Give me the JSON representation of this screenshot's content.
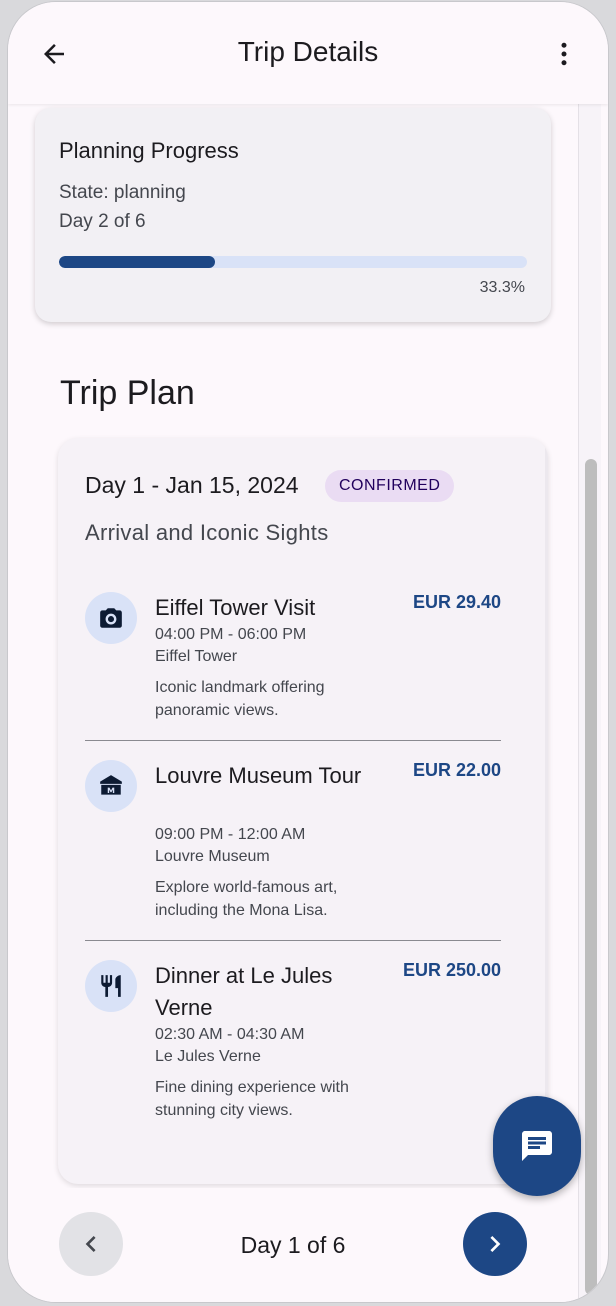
{
  "appbar": {
    "title": "Trip Details",
    "back_icon": "arrow-back-icon",
    "menu_icon": "more-vert-icon"
  },
  "progress": {
    "title": "Planning Progress",
    "state": "State: planning",
    "day": "Day 2 of 6",
    "percent_label": "33.3%",
    "percent": 33.3
  },
  "section_title": "Trip Plan",
  "day": {
    "heading": "Day 1 - Jan 15, 2024",
    "status": "CONFIRMED",
    "subtitle": "Arrival and Iconic Sights",
    "activities": [
      {
        "icon": "camera-icon",
        "title": "Eiffel Tower Visit",
        "price": "EUR 29.40",
        "time": "04:00 PM - 06:00 PM",
        "place": "Eiffel Tower",
        "description": "Iconic landmark offering panoramic views."
      },
      {
        "icon": "museum-icon",
        "title": "Louvre Museum Tour",
        "price": "EUR 22.00",
        "time": "09:00 PM - 12:00 AM",
        "place": "Louvre Museum",
        "description": "Explore world-famous art, including the Mona Lisa."
      },
      {
        "icon": "restaurant-icon",
        "title": "Dinner at Le Jules Verne",
        "price": "EUR 250.00",
        "time": "02:30 AM - 04:30 AM",
        "place": "Le Jules Verne",
        "description": "Fine dining experience with stunning city views."
      }
    ]
  },
  "nav": {
    "indicator": "Day 1 of 6",
    "prev_icon": "chevron-left-icon",
    "next_icon": "chevron-right-icon"
  },
  "fab_icon": "chat-icon",
  "colors": {
    "primary": "#1d4785",
    "badge_bg": "#eadcf3",
    "icon_bg": "#d9e2f7"
  }
}
